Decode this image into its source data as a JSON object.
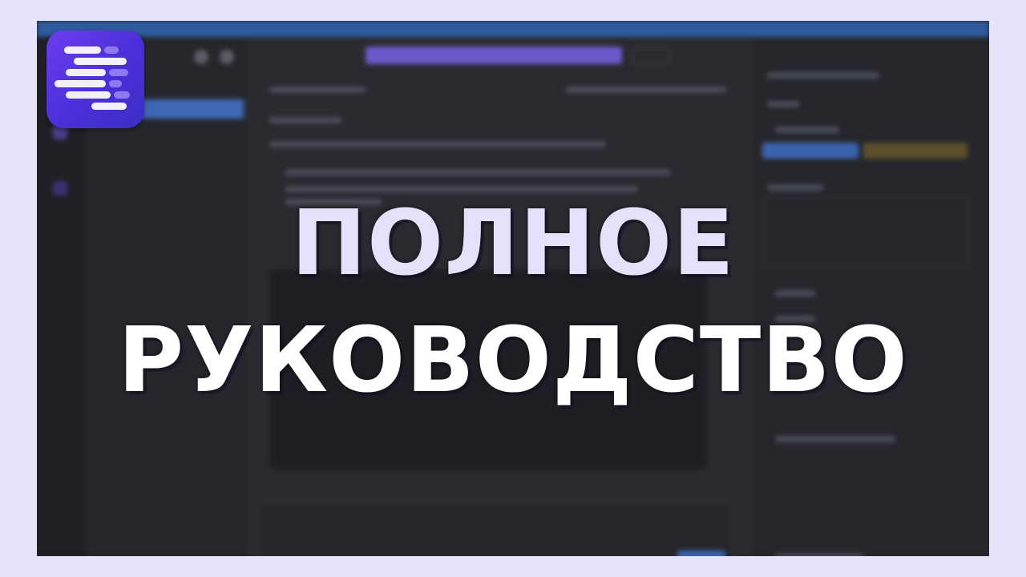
{
  "headline": {
    "line1": "ПОЛНОЕ",
    "line2": "РУКОВОДСТВО"
  },
  "logo": {
    "icon": "text-lines-logo",
    "gradient_start": "#6c3df0",
    "gradient_end": "#3a2fc4"
  },
  "colors": {
    "background": "#e7e3fb",
    "window": "#23242a",
    "accent_blue": "#3f67b5",
    "accent_purple": "#6c58c9"
  }
}
